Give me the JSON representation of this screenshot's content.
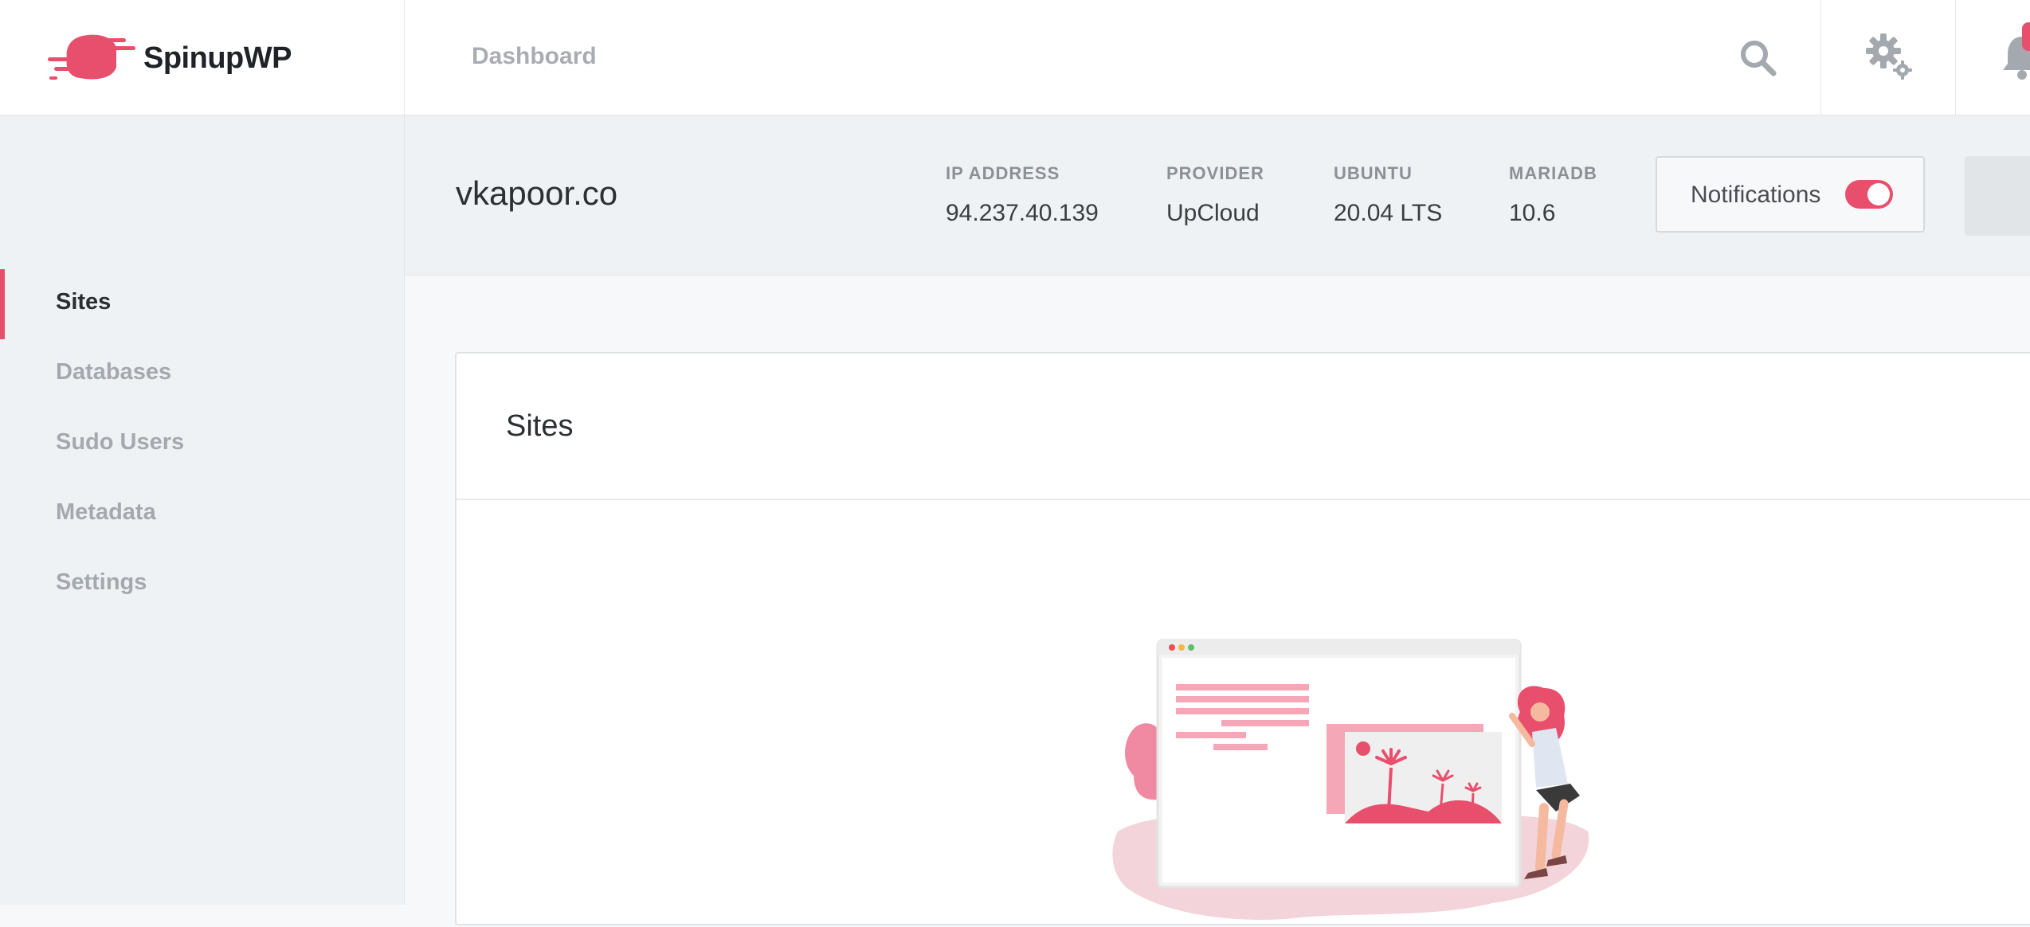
{
  "brand": {
    "name": "SpinupWP",
    "logo_icon": "spinupwp-logo-icon"
  },
  "header": {
    "breadcrumb": "Dashboard",
    "icons": [
      "search-icon",
      "gear-icon",
      "bell-icon"
    ]
  },
  "sidebar": {
    "items": [
      {
        "label": "Sites",
        "active": true
      },
      {
        "label": "Databases",
        "active": false
      },
      {
        "label": "Sudo Users",
        "active": false
      },
      {
        "label": "Metadata",
        "active": false
      },
      {
        "label": "Settings",
        "active": false
      }
    ]
  },
  "server": {
    "name": "vkapoor.co",
    "meta": [
      {
        "label": "IP ADDRESS",
        "value": "94.237.40.139"
      },
      {
        "label": "PROVIDER",
        "value": "UpCloud"
      },
      {
        "label": "UBUNTU",
        "value": "20.04 LTS"
      },
      {
        "label": "MARIADB",
        "value": "10.6"
      }
    ],
    "notifications_label": "Notifications",
    "notifications_on": true
  },
  "card": {
    "title": "Sites"
  },
  "colors": {
    "accent": "#e84f6d",
    "sidebar_bg": "#eff2f4",
    "muted_text": "#a4a9af"
  }
}
